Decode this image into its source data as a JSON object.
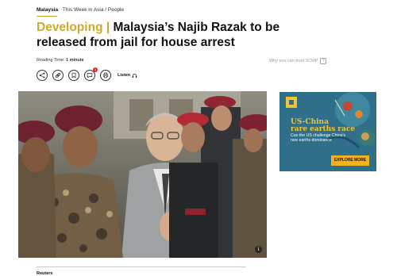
{
  "breadcrumb": {
    "section": "Malaysia",
    "topics": "This Week in Asia / People"
  },
  "headline": {
    "kicker": "Developing",
    "separator": " | ",
    "title": "Malaysia’s Najib Razak to be released from jail for house arrest"
  },
  "meta": {
    "reading_label": "Reading Time:",
    "reading_value": "1 minute",
    "trust_text": "Why you can trust SCMP",
    "trust_icon": "info-square-icon"
  },
  "toolbar": {
    "comment_count": "1",
    "listen_label": "Listen",
    "icons": [
      "share-icon",
      "link-icon",
      "bookmark-icon",
      "comment-icon",
      "print-icon",
      "headphones-icon"
    ]
  },
  "photo": {
    "info_glyph": "i"
  },
  "ad": {
    "title_line1": "US-China",
    "title_line2": "rare earths race",
    "subtitle": "Can the US challenge China's rare earths dominance",
    "cta": "EXPLORE MORE",
    "colors": {
      "background": "#2f6f8a",
      "title": "#f2c531",
      "cta": "#f2b21b"
    }
  },
  "source_label": "Reuters",
  "colors": {
    "kicker": "#d1a92a",
    "badge": "#e02a2a"
  }
}
